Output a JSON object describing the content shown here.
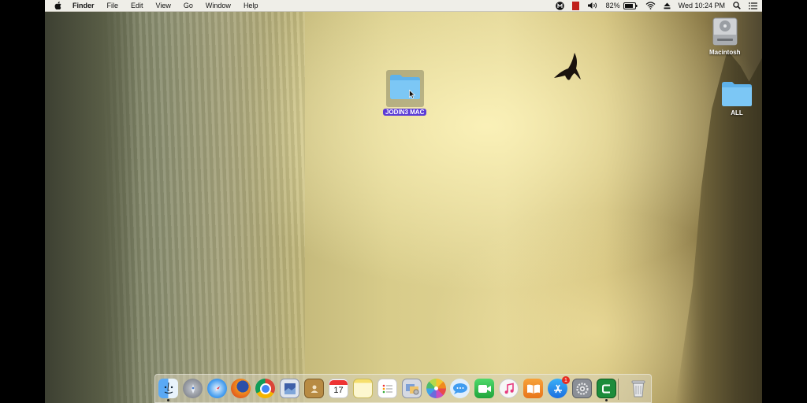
{
  "menubar": {
    "app_name": "Finder",
    "menus": [
      "File",
      "Edit",
      "View",
      "Go",
      "Window",
      "Help"
    ],
    "battery_percent": "82%",
    "clock": "Wed 10:24 PM"
  },
  "desktop": {
    "selected_folder_label": "JODIN3 MAC",
    "drive_label": "Macintosh",
    "folder_all_label": "ALL"
  },
  "dock": {
    "apps": [
      {
        "name": "Finder",
        "color": "#3d8fe6"
      },
      {
        "name": "Launchpad",
        "color": "#8a8f99"
      },
      {
        "name": "Safari",
        "color": "#1f7fe0"
      },
      {
        "name": "Firefox",
        "color": "#e0611c"
      },
      {
        "name": "Chrome",
        "color": "#ffffff"
      },
      {
        "name": "Preview",
        "color": "#3d5a9e"
      },
      {
        "name": "Contacts",
        "color": "#b0853a"
      },
      {
        "name": "Calendar",
        "color": "#ffffff"
      },
      {
        "name": "Notes",
        "color": "#f5e27a"
      },
      {
        "name": "Reminders",
        "color": "#ffffff"
      },
      {
        "name": "Photo Booth",
        "color": "#c4c9d6"
      },
      {
        "name": "Photos",
        "color": "#ffffff"
      },
      {
        "name": "Messages",
        "color": "#4aa3f2"
      },
      {
        "name": "FaceTime",
        "color": "#2fbf4f"
      },
      {
        "name": "iTunes",
        "color": "#f2f2f2"
      },
      {
        "name": "iBooks",
        "color": "#f08a1e"
      },
      {
        "name": "App Store",
        "color": "#2a8ff0"
      },
      {
        "name": "System Preferences",
        "color": "#7d8087"
      },
      {
        "name": "Camtasia",
        "color": "#1f8a3a"
      },
      {
        "name": "Trash",
        "color": "#d0d0d0"
      }
    ],
    "calendar_day": "17",
    "app_store_badge": "1"
  }
}
